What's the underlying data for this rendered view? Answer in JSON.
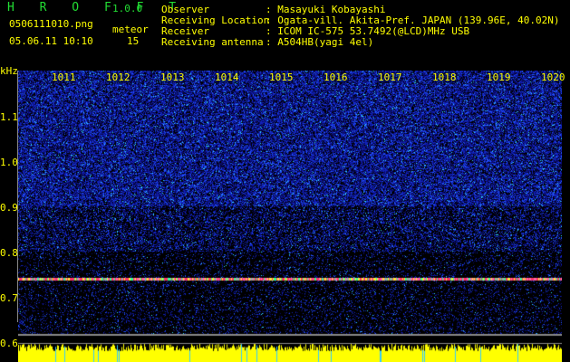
{
  "app": {
    "name": "H R O F F T",
    "version": "1.0.0"
  },
  "file": {
    "name": "0506111010.png",
    "datetime": "05.06.11 10:10"
  },
  "meteor": {
    "label": "meteor",
    "count": "15"
  },
  "info": {
    "observer_label": "Observer",
    "observer": "Masayuki Kobayashi",
    "location_label": "Receiving Location",
    "location": "Ogata-vill. Akita-Pref. JAPAN (139.96E, 40.02N)",
    "receiver_label": "Receiver",
    "receiver": "ICOM IC-575 53.7492(@LCD)MHz USB",
    "antenna_label": "Receiving antenna",
    "antenna": "A504HB(yagi 4el)"
  },
  "spectrogram": {
    "y_unit": "kHz",
    "y_ticks": [
      "1.1",
      "1.0",
      "0.9",
      "0.8",
      "0.7",
      "0.6"
    ],
    "x_ticks": [
      "1011",
      "1012",
      "1013",
      "1014",
      "1015",
      "1016",
      "1017",
      "1018",
      "1019",
      "1020"
    ],
    "carrier_khz": 0.74,
    "colors": {
      "text": "#ffff00",
      "title": "#22dd33",
      "background": "#000000"
    }
  }
}
